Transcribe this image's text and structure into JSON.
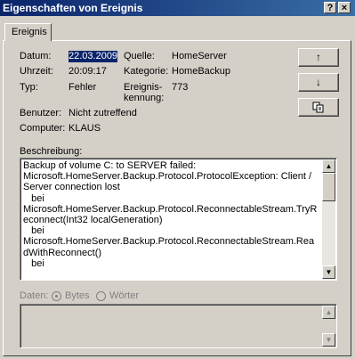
{
  "window": {
    "title": "Eigenschaften von Ereignis",
    "help_glyph": "?",
    "close_glyph": "×"
  },
  "tab": {
    "label": "Ereignis"
  },
  "fields": {
    "datum_label": "Datum:",
    "datum_value": "22.03.2009",
    "uhrzeit_label": "Uhrzeit:",
    "uhrzeit_value": "20:09:17",
    "typ_label": "Typ:",
    "typ_value": "Fehler",
    "benutzer_label": "Benutzer:",
    "benutzer_value": "Nicht zutreffend",
    "computer_label": "Computer:",
    "computer_value": "KLAUS",
    "quelle_label": "Quelle:",
    "quelle_value": "HomeServer",
    "kategorie_label": "Kategorie:",
    "kategorie_value": "HomeBackup",
    "ereignis_label_1": "Ereignis-",
    "ereignis_label_2": "kennung:",
    "ereignis_value": "773"
  },
  "nav": {
    "up_glyph": "↑",
    "down_glyph": "↓",
    "copy_icon": "copy-icon"
  },
  "description": {
    "label": "Beschreibung:",
    "text": "Backup of volume C: to SERVER failed:\nMicrosoft.HomeServer.Backup.Protocol.ProtocolException: Client / Server connection lost\n   bei\nMicrosoft.HomeServer.Backup.Protocol.ReconnectableStream.TryReconnect(Int32 localGeneration)\n   bei\nMicrosoft.HomeServer.Backup.Protocol.ReconnectableStream.ReadWithReconnect()\n   bei"
  },
  "data_section": {
    "label": "Daten:",
    "option_bytes": "Bytes",
    "option_woerter": "Wörter",
    "selected": "Bytes"
  },
  "scroll": {
    "up_glyph": "▲",
    "down_glyph": "▼"
  }
}
